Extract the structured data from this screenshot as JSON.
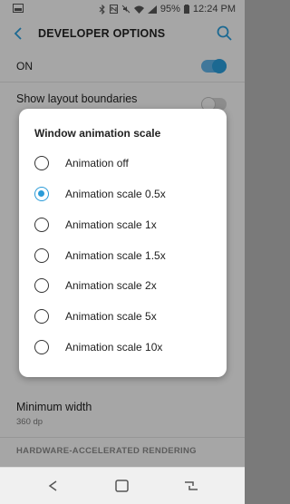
{
  "status_bar": {
    "battery": "95%",
    "time": "12:24 PM"
  },
  "app_bar": {
    "title": "DEVELOPER OPTIONS"
  },
  "master_switch": {
    "label": "ON",
    "on": true
  },
  "list": {
    "show_layout_boundaries": "Show layout boundaries",
    "minimum_width_title": "Minimum width",
    "minimum_width_value": "360 dp",
    "section_header": "HARDWARE-ACCELERATED RENDERING"
  },
  "dialog": {
    "title": "Window animation scale",
    "options": [
      {
        "label": "Animation off",
        "selected": false
      },
      {
        "label": "Animation scale 0.5x",
        "selected": true
      },
      {
        "label": "Animation scale 1x",
        "selected": false
      },
      {
        "label": "Animation scale 1.5x",
        "selected": false
      },
      {
        "label": "Animation scale 2x",
        "selected": false
      },
      {
        "label": "Animation scale 5x",
        "selected": false
      },
      {
        "label": "Animation scale 10x",
        "selected": false
      }
    ]
  },
  "colors": {
    "accent": "#2a9bd8"
  }
}
